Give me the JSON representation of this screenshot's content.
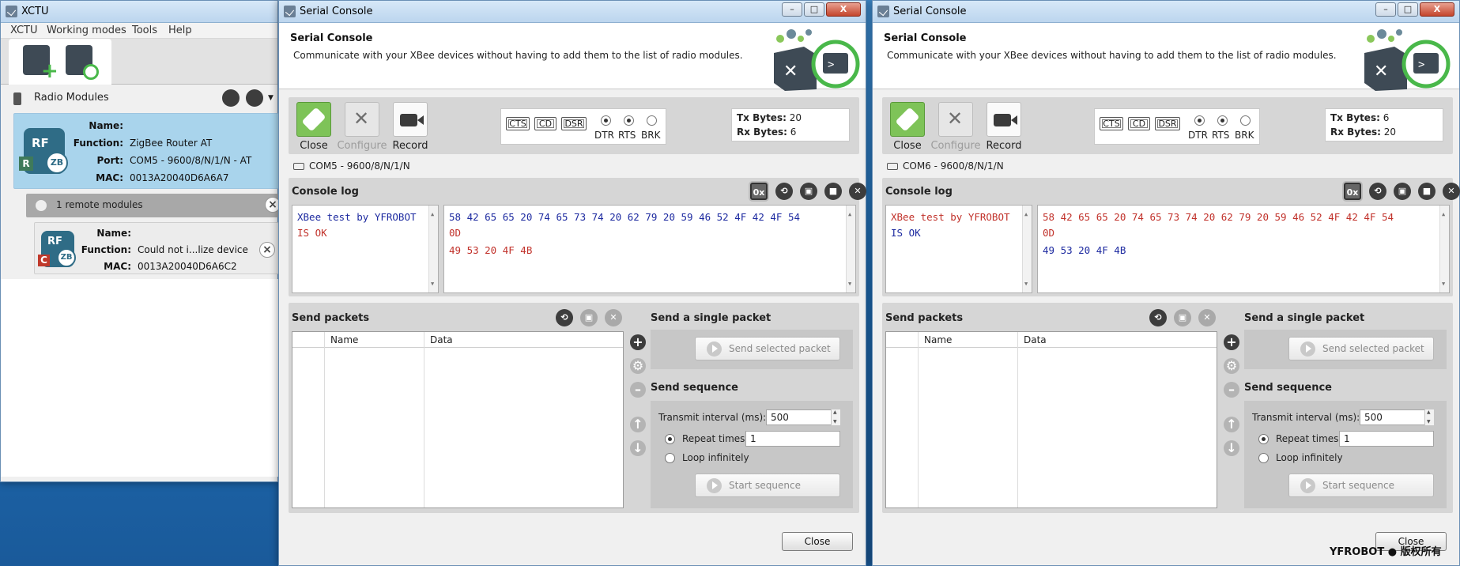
{
  "xctu": {
    "title": "XCTU",
    "menu": [
      "XCTU",
      "Working modes",
      "Tools",
      "Help"
    ],
    "radio_modules_label": "Radio Modules",
    "local_module": {
      "name_label": "Name:",
      "name_value": "",
      "function_label": "Function:",
      "function_value": "ZigBee Router AT",
      "port_label": "Port:",
      "port_value": "COM5 - 9600/8/N/1/N - AT",
      "mac_label": "MAC:",
      "mac_value": "0013A20040D6A6A7",
      "badge": "R"
    },
    "remote_header": "1 remote modules",
    "remote_module": {
      "name_label": "Name:",
      "name_value": "",
      "function_label": "Function:",
      "function_value": "Could not i...lize device",
      "mac_label": "MAC:",
      "mac_value": "0013A20040D6A6C2",
      "badge": "C"
    },
    "icon_text": {
      "rf": "RF",
      "zb": "ZB"
    }
  },
  "console_left": {
    "title": "Serial Console",
    "heading": "Serial Console",
    "subheading": "Communicate with your XBee devices without having to add them to the list of radio modules.",
    "toolbar": {
      "close": "Close",
      "configure": "Configure",
      "record": "Record"
    },
    "signals": {
      "cts": "CTS",
      "cd": "CD",
      "dsr": "DSR",
      "dtr": "DTR",
      "rts": "RTS",
      "brk": "BRK"
    },
    "tx_label": "Tx Bytes:",
    "tx_value": "20",
    "rx_label": "Rx Bytes:",
    "rx_value": "6",
    "port": "COM5 - 9600/8/N/1/N",
    "console_log_label": "Console log",
    "hex_toggle": "0x",
    "log_ascii": [
      "XBee test by YFROBOT",
      "IS OK"
    ],
    "log_hex": [
      "58 42 65 65 20 74 65 73 74 20 62 79 20 59 46 52 4F 42 4F 54",
      "0D",
      "49 53 20 4F 4B"
    ],
    "send_packets_label": "Send packets",
    "col_name": "Name",
    "col_data": "Data",
    "send_single_label": "Send a single packet",
    "send_selected_btn": "Send selected packet",
    "send_sequence_label": "Send sequence",
    "transmit_interval_label": "Transmit interval (ms):",
    "transmit_interval_value": "500",
    "repeat_times_label": "Repeat times",
    "repeat_times_value": "1",
    "loop_label": "Loop infinitely",
    "start_sequence_btn": "Start sequence",
    "close_btn": "Close"
  },
  "console_right": {
    "title": "Serial Console",
    "heading": "Serial Console",
    "subheading": "Communicate with your XBee devices without having to add them to the list of radio modules.",
    "toolbar": {
      "close": "Close",
      "configure": "Configure",
      "record": "Record"
    },
    "signals": {
      "cts": "CTS",
      "cd": "CD",
      "dsr": "DSR",
      "dtr": "DTR",
      "rts": "RTS",
      "brk": "BRK"
    },
    "tx_label": "Tx Bytes:",
    "tx_value": "6",
    "rx_label": "Rx Bytes:",
    "rx_value": "20",
    "port": "COM6 - 9600/8/N/1/N",
    "console_log_label": "Console log",
    "hex_toggle": "0x",
    "log_ascii": [
      "XBee test by YFROBOT",
      "IS OK"
    ],
    "log_hex": [
      "58 42 65 65 20 74 65 73 74 20 62 79 20 59 46 52 4F 42 4F 54",
      "0D",
      "49 53 20 4F 4B"
    ],
    "send_packets_label": "Send packets",
    "col_name": "Name",
    "col_data": "Data",
    "send_single_label": "Send a single packet",
    "send_selected_btn": "Send selected packet",
    "send_sequence_label": "Send sequence",
    "transmit_interval_label": "Transmit interval (ms):",
    "transmit_interval_value": "500",
    "repeat_times_label": "Repeat times",
    "repeat_times_value": "1",
    "loop_label": "Loop infinitely",
    "start_sequence_btn": "Start sequence",
    "close_btn": "Close"
  },
  "window_buttons": {
    "minimize": "–",
    "maximize": "□",
    "close": "X"
  },
  "watermark": "YFROBOT ● 版权所有",
  "colors": {
    "accent_green": "#49b84a",
    "log_blue": "#1d2aa0",
    "log_red": "#c1312a",
    "card_blue": "#a9d4ec"
  }
}
